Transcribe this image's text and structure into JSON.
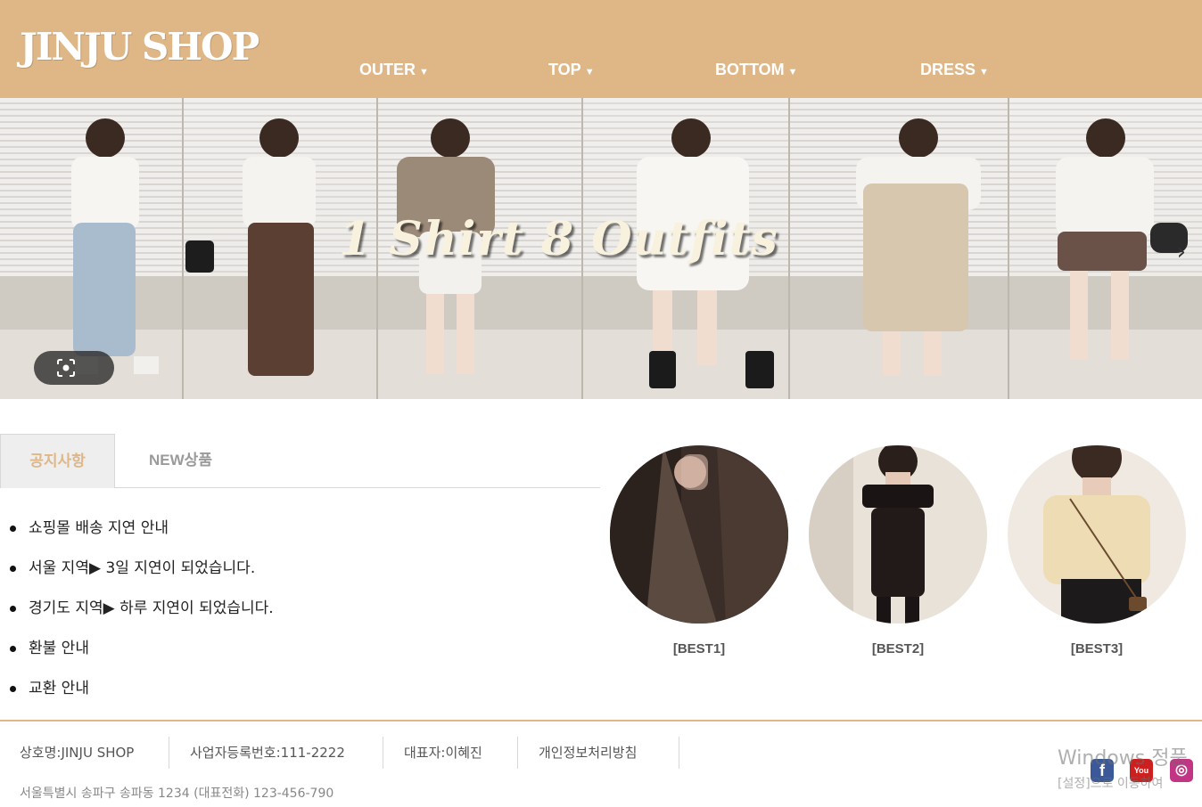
{
  "header": {
    "logo": "JINJU SHOP",
    "nav": [
      {
        "label": "OUTER",
        "caret": "▼"
      },
      {
        "label": "TOP",
        "caret": "▼"
      },
      {
        "label": "BOTTOM",
        "caret": "▼"
      },
      {
        "label": "DRESS",
        "caret": "▼"
      }
    ]
  },
  "hero": {
    "title": "1 Shirt  8 Outfits",
    "next_arrow": "›"
  },
  "tabs": {
    "active": "공지사항",
    "inactive": "NEW상품"
  },
  "notices": [
    "쇼핑몰 배송 지연 안내",
    "서울 지역▶ 3일 지연이 되었습니다.",
    "경기도 지역▶ 하루 지연이 되었습니다.",
    "환불 안내",
    "교환 안내"
  ],
  "best": [
    {
      "caption": "[BEST1]"
    },
    {
      "caption": "[BEST2]"
    },
    {
      "caption": "[BEST3]"
    }
  ],
  "footer": {
    "company": "상호명:JINJU SHOP",
    "biz_no": "사업자등록번호:111-2222",
    "ceo": "대표자:이혜진",
    "privacy": "개인정보처리방침",
    "address": "서울특별시 송파구 송파동 1234 (대표전화) 123-456-790"
  },
  "social": [
    {
      "icon": "facebook-icon",
      "glyph": "f",
      "color": "#3b5998"
    },
    {
      "icon": "youtube-icon",
      "glyph": "You",
      "color": "#cc1f1f"
    },
    {
      "icon": "instagram-icon",
      "glyph": "◎",
      "color": "#c13584"
    }
  ],
  "watermark": {
    "line1": "Windows 정품",
    "line2": "[설정]으로 이동하여"
  },
  "colors": {
    "brand": "#dfb787",
    "active_tab_text": "#dfb787"
  }
}
